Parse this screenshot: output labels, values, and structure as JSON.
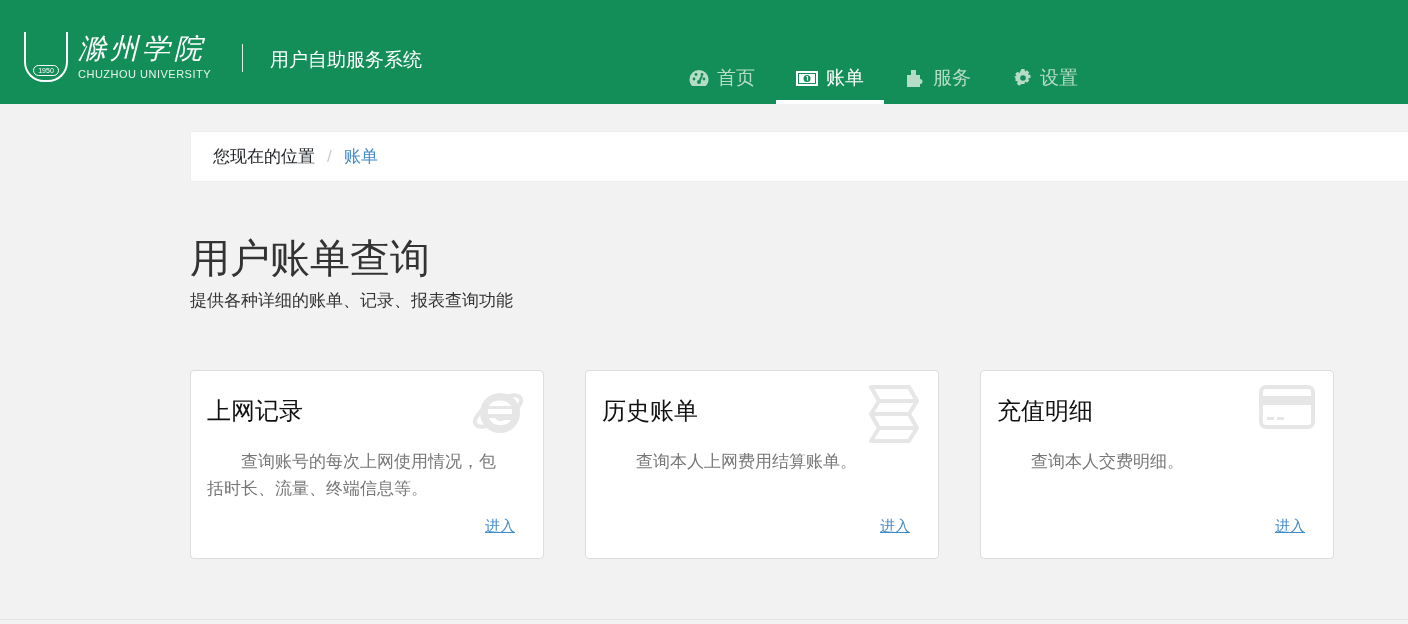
{
  "header": {
    "logo": {
      "name": "滁州学院",
      "english": "CHUZHOU UNIVERSITY",
      "year": "1950"
    },
    "title": "用户自助服务系统",
    "nav": [
      {
        "label": "首页",
        "kind": "dashboard",
        "selected": false
      },
      {
        "label": "账单",
        "kind": "money",
        "selected": true
      },
      {
        "label": "服务",
        "kind": "puzzle",
        "selected": false
      },
      {
        "label": "设置",
        "kind": "gear",
        "selected": false
      }
    ]
  },
  "breadcrumb": {
    "separator": "/",
    "items": [
      {
        "label": "您现在的位置",
        "link": false
      },
      {
        "label": "账单",
        "link": true
      }
    ]
  },
  "heading": "用户账单查询",
  "subtitle": "提供各种详细的账单、记录、报表查询功能",
  "cards": [
    {
      "title": "上网记录",
      "kind": "browser",
      "description": "查询账号的每次上网使用情况，包括时长、流量、终端信息等。",
      "link": "进入"
    },
    {
      "title": "历史账单",
      "kind": "map",
      "description": "查询本人上网费用结算账单。",
      "link": "进入"
    },
    {
      "title": "充值明细",
      "kind": "card",
      "description": "查询本人交费明细。",
      "link": "进入"
    }
  ]
}
